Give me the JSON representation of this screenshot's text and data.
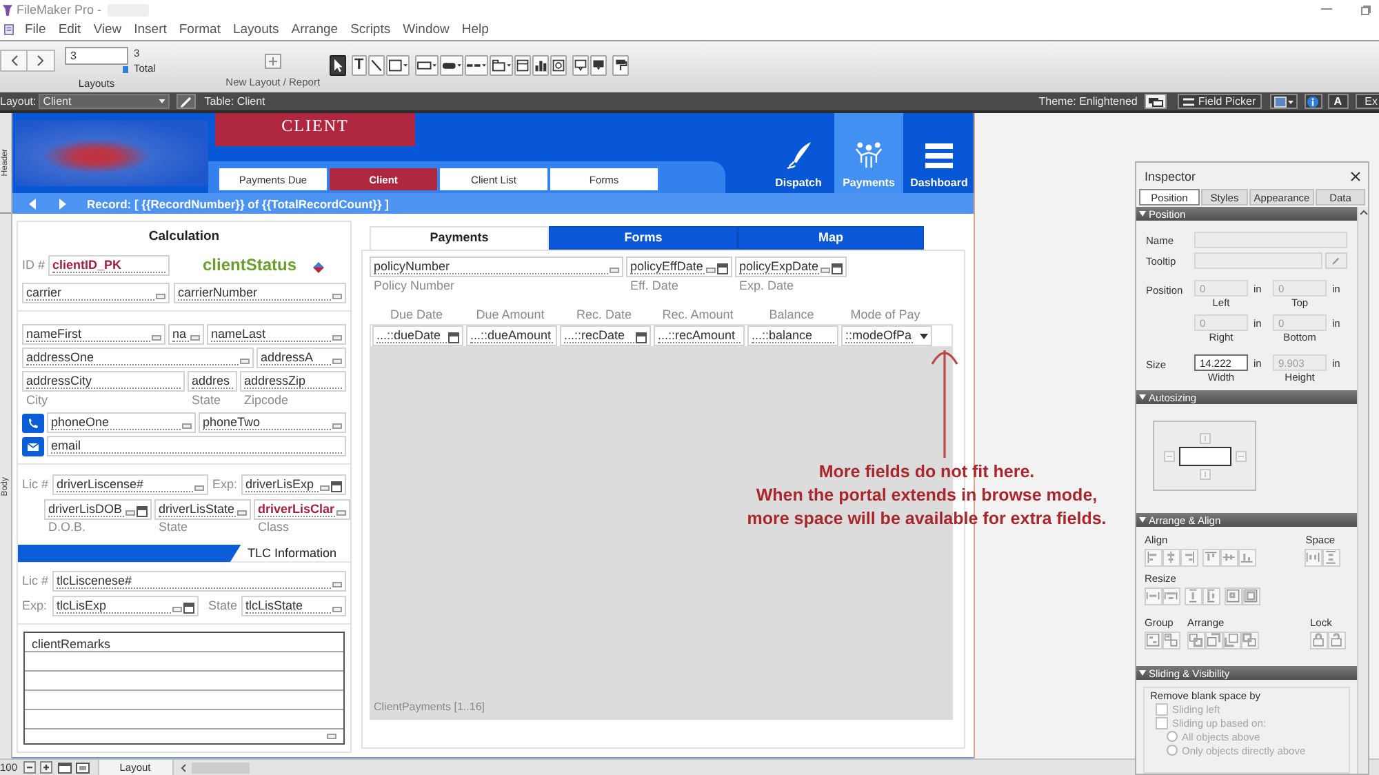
{
  "window": {
    "title": "FileMaker Pro -"
  },
  "menu": [
    "File",
    "Edit",
    "View",
    "Insert",
    "Format",
    "Layouts",
    "Arrange",
    "Scripts",
    "Window",
    "Help"
  ],
  "toolbar": {
    "record_field": "3",
    "total_count": "3",
    "total_label": "Total",
    "slider": {
      "level": 1
    },
    "layouts_label": "Layouts",
    "new_layout_label": "New Layout / Report",
    "tool_groups": [
      [
        {
          "kind": "pointer",
          "selected": true
        }
      ],
      [
        {
          "kind": "text",
          "label": "T",
          "selected": false
        },
        {
          "kind": "line",
          "selected": false
        },
        {
          "kind": "shape",
          "selected": false
        }
      ],
      [
        {
          "kind": "field",
          "selected": false
        },
        {
          "kind": "button",
          "selected": false
        },
        {
          "kind": "button_bar",
          "selected": false
        },
        {
          "kind": "tab_control",
          "selected": false
        },
        {
          "kind": "portal",
          "selected": false
        },
        {
          "kind": "chart",
          "selected": false
        },
        {
          "kind": "web_viewer",
          "selected": false
        }
      ],
      [
        {
          "kind": "popover",
          "selected": false
        },
        {
          "kind": "slide_control",
          "selected": false
        }
      ],
      [
        {
          "kind": "format_painter",
          "selected": false
        }
      ]
    ]
  },
  "layout_bar": {
    "layout_label": "Layout:",
    "layout_value": "Client",
    "table_label": "Table: Client",
    "theme_label": "Theme: Enlightened",
    "field_picker": "Field Picker",
    "font_button": "A",
    "exit_button": "Ex"
  },
  "part_labels": [
    "Header",
    "Body"
  ],
  "header": {
    "title": "CLIENT",
    "tabs": [
      {
        "label": "Payments Due",
        "selected": false
      },
      {
        "label": "Client",
        "selected": true
      },
      {
        "label": "Client List",
        "selected": false
      },
      {
        "label": "Forms",
        "selected": false
      }
    ],
    "nav": [
      {
        "kind": "pen",
        "label": "Dispatch",
        "selected": false
      },
      {
        "kind": "people",
        "label": "Payments",
        "selected": true
      },
      {
        "kind": "menu",
        "label": "Dashboard",
        "selected": false
      }
    ],
    "record_line": "Record: [ {{RecordNumber}} of {{TotalRecordCount}} ]"
  },
  "client_form": {
    "section_title": "Calculation",
    "id_label": "ID #",
    "id_field": {
      "name": "clientID_PK",
      "color": "#a3213f"
    },
    "status_field": "clientStatus",
    "carrier_row": [
      {
        "name": "carrier",
        "kind": "text"
      },
      {
        "name": "carrierNumber",
        "kind": "text"
      }
    ],
    "name_row": [
      {
        "name": "nameFirst",
        "kind": "text"
      },
      {
        "name": "na",
        "kind": "text"
      },
      {
        "name": "nameLast",
        "kind": "text"
      }
    ],
    "address_row": [
      {
        "name": "addressOne",
        "kind": "text"
      },
      {
        "name": "addressA",
        "kind": "text"
      }
    ],
    "city_row": [
      {
        "name": "addressCity"
      },
      {
        "name": "addres"
      },
      {
        "name": "addressZip"
      }
    ],
    "city_labels": [
      "City",
      "State",
      "Zipcode"
    ],
    "phone_row": [
      {
        "name": "phoneOne",
        "kind": "text"
      },
      {
        "name": "phoneTwo",
        "kind": "text"
      }
    ],
    "email_field": {
      "name": "email"
    },
    "license_label": "Lic #",
    "license_field": {
      "name": "driverLiscense#",
      "kind": "text"
    },
    "exp_label": "Exp:",
    "exp_field": {
      "name": "driverLisExp",
      "kind": "date"
    },
    "driver_row": [
      {
        "name": "driverLisDOB",
        "kind": "date"
      },
      {
        "name": "driverLisState",
        "kind": "text"
      },
      {
        "name": "driverLisClar",
        "kind": "text",
        "color": "#a3213f"
      }
    ],
    "driver_labels": [
      "D.O.B.",
      "State",
      "Class"
    ],
    "tlc_title": "TLC Information",
    "tlc_license_label": "Lic #",
    "tlc_license_field": {
      "name": "tlcLiscenese#",
      "kind": "text"
    },
    "tlc_exp_label": "Exp:",
    "tlc_exp_field": {
      "name": "tlcLisExp",
      "kind": "date"
    },
    "tlc_state_label": "State",
    "tlc_state_field": {
      "name": "tlcLisState",
      "kind": "text"
    },
    "remarks_field": {
      "name": "clientRemarks",
      "kind": "text"
    }
  },
  "payments_panel": {
    "tabs": [
      {
        "label": "Payments",
        "selected": true
      },
      {
        "label": "Forms",
        "selected": false
      },
      {
        "label": "Map",
        "selected": false
      }
    ],
    "policy_fields": [
      {
        "name": "policyNumber",
        "kind": "text"
      },
      {
        "name": "policyEffDate",
        "kind": "date"
      },
      {
        "name": "policyExpDate",
        "kind": "date"
      }
    ],
    "policy_labels": [
      "Policy Number",
      "Eff. Date",
      "Exp. Date"
    ],
    "portal": {
      "columns": [
        "Due Date",
        "Due Amount",
        "Rec. Date",
        "Rec. Amount",
        "Balance",
        "Mode of Pay"
      ],
      "fields": [
        {
          "name": "...::dueDate",
          "kind": "calendar"
        },
        {
          "name": "...::dueAmount",
          "kind": "plain"
        },
        {
          "name": "...::recDate",
          "kind": "calendar"
        },
        {
          "name": "...::recAmount",
          "kind": "plain"
        },
        {
          "name": "...::balance",
          "kind": "plain"
        },
        {
          "name": "::modeOfPa",
          "kind": "popup"
        }
      ],
      "label": "ClientPayments [1..16]"
    }
  },
  "annotation": {
    "lines": [
      "More fields do not fit here.",
      "When the portal extends in browse mode,",
      "more space will be available for extra fields."
    ]
  },
  "inspector": {
    "title": "Inspector",
    "tabs": [
      {
        "label": "Position",
        "selected": true
      },
      {
        "label": "Styles",
        "selected": false
      },
      {
        "label": "Appearance",
        "selected": false
      },
      {
        "label": "Data",
        "selected": false
      }
    ],
    "position": {
      "header": "Position",
      "name_label": "Name",
      "tooltip_label": "Tooltip",
      "position_label": "Position",
      "size_label": "Size",
      "coords": [
        {
          "value": "0",
          "unit": "in",
          "caption": "Left",
          "disabled": true
        },
        {
          "value": "0",
          "unit": "in",
          "caption": "Top",
          "disabled": true
        },
        {
          "value": "0",
          "unit": "in",
          "caption": "Right",
          "disabled": true
        },
        {
          "value": "0",
          "unit": "in",
          "caption": "Bottom",
          "disabled": true
        }
      ],
      "size": [
        {
          "value": "14.222",
          "unit": "in",
          "caption": "Width",
          "disabled": false
        },
        {
          "value": "9.903",
          "unit": "in",
          "caption": "Height",
          "disabled": true
        }
      ]
    },
    "autosizing": {
      "header": "Autosizing"
    },
    "arrange": {
      "header": "Arrange & Align",
      "align_label": "Align",
      "space_label": "Space",
      "resize_label": "Resize",
      "group_label": "Group",
      "arrange_label": "Arrange",
      "lock_label": "Lock"
    },
    "sliding": {
      "header": "Sliding & Visibility",
      "group_label": "Remove blank space by",
      "options": [
        {
          "kind": "checkbox",
          "label": "Sliding left",
          "checked": false,
          "disabled": true
        },
        {
          "kind": "checkbox",
          "label": "Sliding up based on:",
          "checked": false,
          "disabled": true
        },
        {
          "kind": "radio",
          "label": "All objects above",
          "checked": false,
          "disabled": true
        },
        {
          "kind": "radio",
          "label": "Only objects directly above",
          "checked": false,
          "disabled": true
        }
      ]
    }
  },
  "status_bar": {
    "zoom": "100",
    "mode": "Layout"
  }
}
